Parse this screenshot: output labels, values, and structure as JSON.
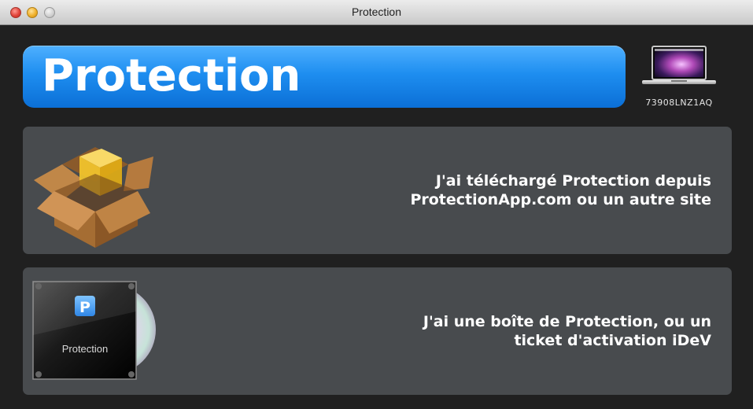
{
  "window": {
    "title": "Protection",
    "buttons": [
      "close",
      "minimize",
      "zoom"
    ]
  },
  "banner": {
    "label": "Protection",
    "color": "#1e8ef0"
  },
  "computer": {
    "icon": "laptop-icon",
    "serial": "73908LNZ1AQ"
  },
  "options": [
    {
      "icon": "package-box-icon",
      "label": "J'ai téléchargé Protection depuis\nProtectionApp.com ou un autre site"
    },
    {
      "icon": "cd-case-icon",
      "icon_caption": "Protection",
      "icon_badge": "P",
      "label": "J'ai une boîte de Protection, ou un \nticket d'activation iDeV"
    }
  ]
}
